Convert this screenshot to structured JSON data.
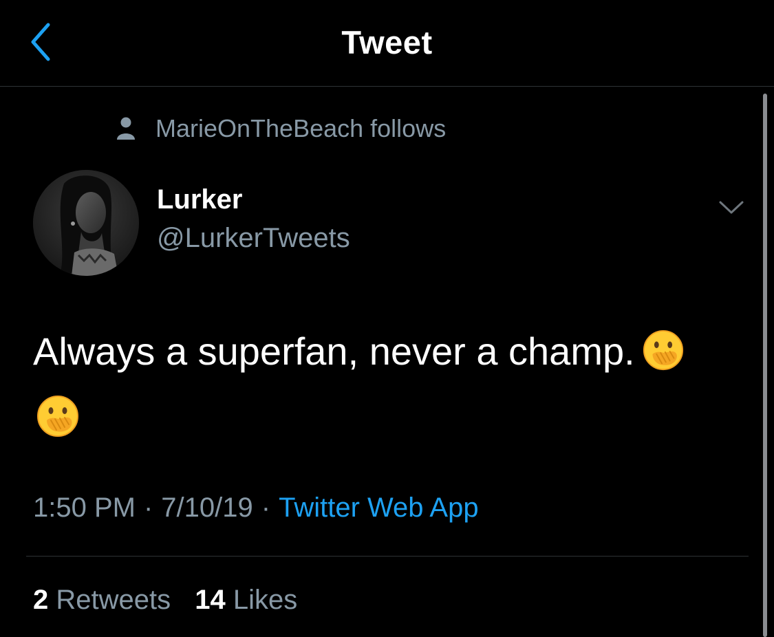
{
  "header": {
    "title": "Tweet",
    "back_icon": "chevron-left-icon",
    "accent_color": "#1da1f2"
  },
  "social_context": {
    "icon": "person-icon",
    "text": "MarieOnTheBeach follows"
  },
  "author": {
    "name": "Lurker",
    "handle": "@LurkerTweets"
  },
  "tweet": {
    "text": "Always a superfan, never a champ.",
    "emoji": "face-with-hand-over-mouth"
  },
  "meta": {
    "time": "1:50 PM",
    "date": "7/10/19",
    "separator": "·",
    "source": "Twitter Web App"
  },
  "stats": {
    "retweets_count": "2",
    "retweets_label": "Retweets",
    "likes_count": "14",
    "likes_label": "Likes"
  }
}
